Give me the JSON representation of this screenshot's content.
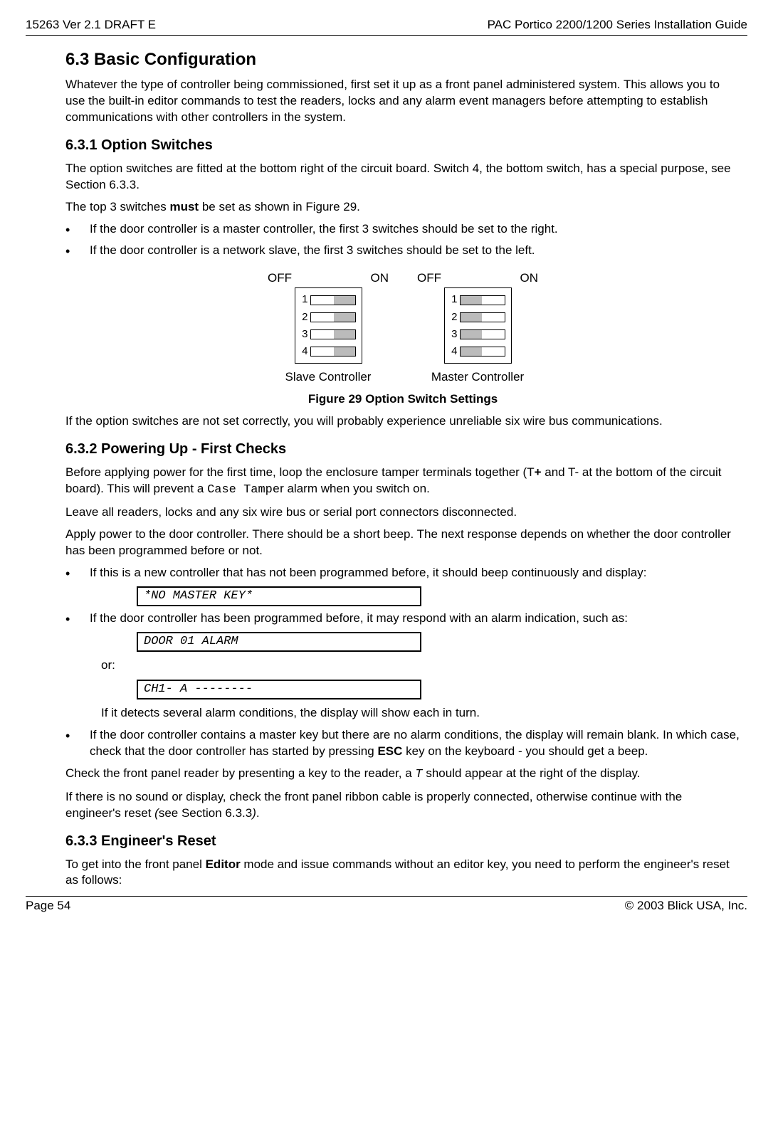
{
  "header": {
    "left": "15263 Ver 2.1 DRAFT E",
    "right": "PAC Portico 2200/1200 Series Installation Guide"
  },
  "s63": {
    "title": "6.3 Basic Configuration",
    "intro": "Whatever the type of controller being commissioned, first set it up as a front panel administered system. This allows you to use the built-in editor commands to test the readers, locks and any alarm event managers before attempting to establish communications with other controllers in the system."
  },
  "s631": {
    "title": "6.3.1 Option Switches",
    "p1": "The option switches are fitted at the bottom right of the circuit board. Switch 4, the bottom switch, has a special purpose, see Section 6.3.3.",
    "p2a": "The top 3 switches ",
    "p2b": "must",
    "p2c": " be set as shown in Figure 29.",
    "b1": "If the door controller is a master controller, the first 3 switches should be set to the right.",
    "b2": "If the door controller is a network slave, the first 3 switches should be set to the left.",
    "off": "OFF",
    "on": "ON",
    "slave": "Slave Controller",
    "master": "Master Controller",
    "figcap": "Figure 29 Option Switch Settings",
    "p3": "If the option switches are not set correctly, you will probably experience unreliable six wire bus communications."
  },
  "s632": {
    "title": "6.3.2 Powering Up - First Checks",
    "p1a": "Before applying power for the first time, loop the enclosure tamper terminals together (T",
    "p1b": "+",
    "p1c": " and T- at the bottom of the circuit board). This will prevent a ",
    "p1d": "Case Tampe",
    "p1e": "r alarm when you switch on.",
    "p2": "Leave all readers, locks and any six wire bus or serial port connectors disconnected.",
    "p3": "Apply power to the door controller. There should be a short beep. The next response depends on whether the door controller has been programmed before or not.",
    "b1": "If this is a new controller that has not been programmed before, it should beep continuously and display:",
    "disp1": "*NO MASTER KEY*",
    "b2": "If the door controller has been programmed before, it may respond with an alarm indication, such as:",
    "disp2": "DOOR 01 ALARM",
    "or": "or:",
    "disp3": "CH1- A --------",
    "b2b": "If it detects several alarm conditions, the display will show each in turn.",
    "b3a": "If the door controller contains a master key but there are no alarm conditions, the display will remain blank. In which case, check that the door controller has started by pressing ",
    "b3b": "ESC",
    "b3c": " key on the keyboard - you should get a beep.",
    "p4a": "Check the front panel reader by presenting a key to the reader, a ",
    "p4T": "T",
    "p4b": " should appear at the right of the display.",
    "p5a": "If there is no sound or display, check the front panel ribbon cable is properly connected, otherwise continue with the engineer's reset ",
    "p5b": "(",
    "p5c": "see Section 6.3.3",
    "p5d": ")",
    "p5e": "."
  },
  "s633": {
    "title": "6.3.3 Engineer's Reset",
    "p1a": "To get into the front panel ",
    "p1b": "Editor",
    "p1c": " mode and issue commands without an editor key, you need to perform the engineer's reset as follows:"
  },
  "footer": {
    "left": "Page 54",
    "right": "© 2003  Blick USA, Inc."
  },
  "nums": {
    "n1": "1",
    "n2": "2",
    "n3": "3",
    "n4": "4"
  }
}
